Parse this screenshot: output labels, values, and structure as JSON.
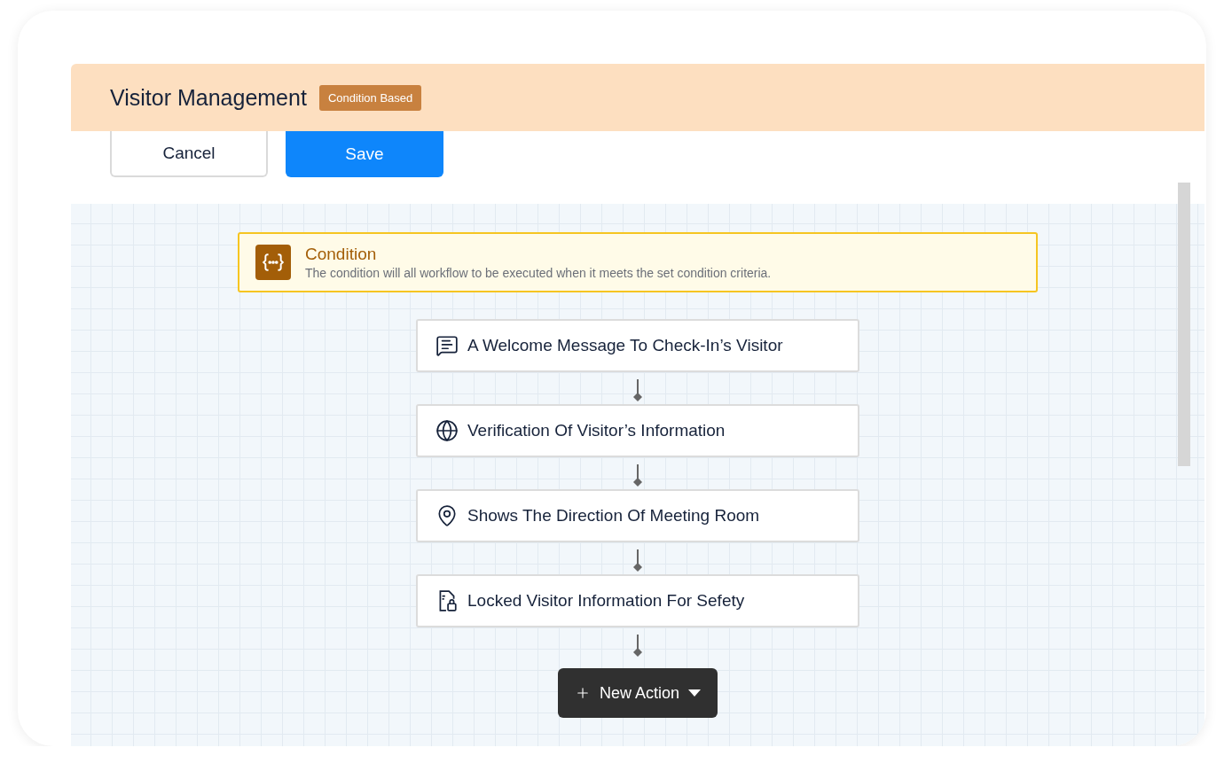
{
  "header": {
    "title": "Visitor Management",
    "badge": "Condition Based"
  },
  "buttons": [
    {
      "kind": "secondary",
      "label": "Cancel"
    },
    {
      "kind": "primary",
      "label": "Save"
    }
  ],
  "condition": {
    "title": "Condition",
    "description": "The condition will all workflow to be executed when it meets the set condition criteria."
  },
  "steps": [
    {
      "kind": "message",
      "label": "A Welcome Message To Check-In’s Visitor"
    },
    {
      "kind": "globe",
      "label": "Verification Of Visitor’s Information"
    },
    {
      "kind": "location",
      "label": "Shows The Direction Of Meeting Room"
    },
    {
      "kind": "locked-document",
      "label": "Locked Visitor Information For Sefety"
    }
  ],
  "new_action": {
    "label": "New Action"
  }
}
